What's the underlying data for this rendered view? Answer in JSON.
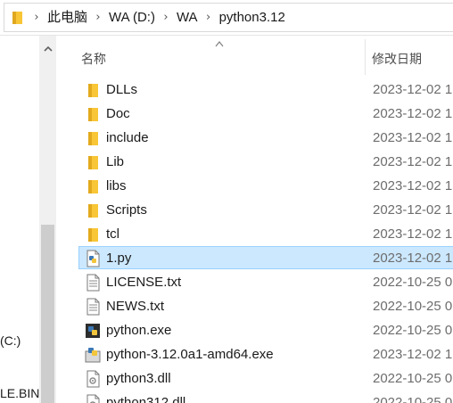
{
  "address": {
    "crumbs": [
      "此电脑",
      "WA (D:)",
      "WA",
      "python3.12"
    ]
  },
  "nav": {
    "items": [
      "(C:)",
      "LE.BIN"
    ]
  },
  "columns": {
    "name": "名称",
    "date": "修改日期"
  },
  "files": [
    {
      "name": "DLLs",
      "date": "2023-12-02 1",
      "icon": "folder-icon",
      "selected": false
    },
    {
      "name": "Doc",
      "date": "2023-12-02 1",
      "icon": "folder-icon",
      "selected": false
    },
    {
      "name": "include",
      "date": "2023-12-02 1",
      "icon": "folder-icon",
      "selected": false
    },
    {
      "name": "Lib",
      "date": "2023-12-02 1",
      "icon": "folder-icon",
      "selected": false
    },
    {
      "name": "libs",
      "date": "2023-12-02 1",
      "icon": "folder-icon",
      "selected": false
    },
    {
      "name": "Scripts",
      "date": "2023-12-02 1",
      "icon": "folder-icon",
      "selected": false
    },
    {
      "name": "tcl",
      "date": "2023-12-02 1",
      "icon": "folder-icon",
      "selected": false
    },
    {
      "name": "1.py",
      "date": "2023-12-02 1",
      "icon": "python-file-icon",
      "selected": true
    },
    {
      "name": "LICENSE.txt",
      "date": "2022-10-25 0",
      "icon": "text-file-icon",
      "selected": false
    },
    {
      "name": "NEWS.txt",
      "date": "2022-10-25 0",
      "icon": "text-file-icon",
      "selected": false
    },
    {
      "name": "python.exe",
      "date": "2022-10-25 0",
      "icon": "python-exe-icon",
      "selected": false
    },
    {
      "name": "python-3.12.0a1-amd64.exe",
      "date": "2023-12-02 1",
      "icon": "installer-icon",
      "selected": false
    },
    {
      "name": "python3.dll",
      "date": "2022-10-25 0",
      "icon": "dll-file-icon",
      "selected": false
    },
    {
      "name": "python312.dll",
      "date": "2022-10-25 0",
      "icon": "dll-file-icon",
      "selected": false
    }
  ],
  "colors": {
    "selection_fill": "#cce8ff",
    "selection_border": "#99d1ff",
    "folder_yellow": "#f8c636"
  }
}
